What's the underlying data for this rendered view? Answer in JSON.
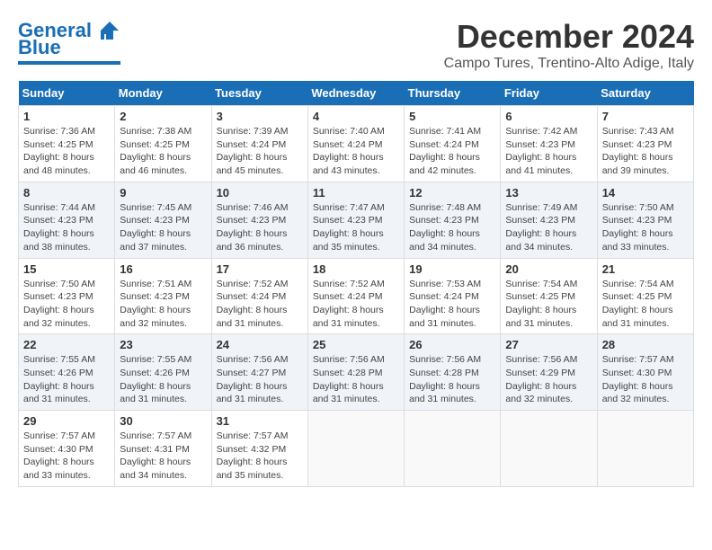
{
  "header": {
    "logo_general": "General",
    "logo_blue": "Blue",
    "title": "December 2024",
    "subtitle": "Campo Tures, Trentino-Alto Adige, Italy"
  },
  "calendar": {
    "days_of_week": [
      "Sunday",
      "Monday",
      "Tuesday",
      "Wednesday",
      "Thursday",
      "Friday",
      "Saturday"
    ],
    "weeks": [
      [
        null,
        null,
        null,
        null,
        null,
        null,
        null
      ]
    ],
    "cells": [
      {
        "day": null,
        "label": ""
      },
      {
        "day": null,
        "label": ""
      },
      {
        "day": null,
        "label": ""
      },
      {
        "day": null,
        "label": ""
      },
      {
        "day": null,
        "label": ""
      },
      {
        "day": null,
        "label": ""
      },
      {
        "day": null,
        "label": ""
      }
    ]
  },
  "days": {
    "week1": [
      {
        "num": "1",
        "sunrise": "Sunrise: 7:36 AM",
        "sunset": "Sunset: 4:25 PM",
        "daylight": "Daylight: 8 hours and 48 minutes."
      },
      {
        "num": "2",
        "sunrise": "Sunrise: 7:38 AM",
        "sunset": "Sunset: 4:25 PM",
        "daylight": "Daylight: 8 hours and 46 minutes."
      },
      {
        "num": "3",
        "sunrise": "Sunrise: 7:39 AM",
        "sunset": "Sunset: 4:24 PM",
        "daylight": "Daylight: 8 hours and 45 minutes."
      },
      {
        "num": "4",
        "sunrise": "Sunrise: 7:40 AM",
        "sunset": "Sunset: 4:24 PM",
        "daylight": "Daylight: 8 hours and 43 minutes."
      },
      {
        "num": "5",
        "sunrise": "Sunrise: 7:41 AM",
        "sunset": "Sunset: 4:24 PM",
        "daylight": "Daylight: 8 hours and 42 minutes."
      },
      {
        "num": "6",
        "sunrise": "Sunrise: 7:42 AM",
        "sunset": "Sunset: 4:23 PM",
        "daylight": "Daylight: 8 hours and 41 minutes."
      },
      {
        "num": "7",
        "sunrise": "Sunrise: 7:43 AM",
        "sunset": "Sunset: 4:23 PM",
        "daylight": "Daylight: 8 hours and 39 minutes."
      }
    ],
    "week2": [
      {
        "num": "8",
        "sunrise": "Sunrise: 7:44 AM",
        "sunset": "Sunset: 4:23 PM",
        "daylight": "Daylight: 8 hours and 38 minutes."
      },
      {
        "num": "9",
        "sunrise": "Sunrise: 7:45 AM",
        "sunset": "Sunset: 4:23 PM",
        "daylight": "Daylight: 8 hours and 37 minutes."
      },
      {
        "num": "10",
        "sunrise": "Sunrise: 7:46 AM",
        "sunset": "Sunset: 4:23 PM",
        "daylight": "Daylight: 8 hours and 36 minutes."
      },
      {
        "num": "11",
        "sunrise": "Sunrise: 7:47 AM",
        "sunset": "Sunset: 4:23 PM",
        "daylight": "Daylight: 8 hours and 35 minutes."
      },
      {
        "num": "12",
        "sunrise": "Sunrise: 7:48 AM",
        "sunset": "Sunset: 4:23 PM",
        "daylight": "Daylight: 8 hours and 34 minutes."
      },
      {
        "num": "13",
        "sunrise": "Sunrise: 7:49 AM",
        "sunset": "Sunset: 4:23 PM",
        "daylight": "Daylight: 8 hours and 34 minutes."
      },
      {
        "num": "14",
        "sunrise": "Sunrise: 7:50 AM",
        "sunset": "Sunset: 4:23 PM",
        "daylight": "Daylight: 8 hours and 33 minutes."
      }
    ],
    "week3": [
      {
        "num": "15",
        "sunrise": "Sunrise: 7:50 AM",
        "sunset": "Sunset: 4:23 PM",
        "daylight": "Daylight: 8 hours and 32 minutes."
      },
      {
        "num": "16",
        "sunrise": "Sunrise: 7:51 AM",
        "sunset": "Sunset: 4:23 PM",
        "daylight": "Daylight: 8 hours and 32 minutes."
      },
      {
        "num": "17",
        "sunrise": "Sunrise: 7:52 AM",
        "sunset": "Sunset: 4:24 PM",
        "daylight": "Daylight: 8 hours and 31 minutes."
      },
      {
        "num": "18",
        "sunrise": "Sunrise: 7:52 AM",
        "sunset": "Sunset: 4:24 PM",
        "daylight": "Daylight: 8 hours and 31 minutes."
      },
      {
        "num": "19",
        "sunrise": "Sunrise: 7:53 AM",
        "sunset": "Sunset: 4:24 PM",
        "daylight": "Daylight: 8 hours and 31 minutes."
      },
      {
        "num": "20",
        "sunrise": "Sunrise: 7:54 AM",
        "sunset": "Sunset: 4:25 PM",
        "daylight": "Daylight: 8 hours and 31 minutes."
      },
      {
        "num": "21",
        "sunrise": "Sunrise: 7:54 AM",
        "sunset": "Sunset: 4:25 PM",
        "daylight": "Daylight: 8 hours and 31 minutes."
      }
    ],
    "week4": [
      {
        "num": "22",
        "sunrise": "Sunrise: 7:55 AM",
        "sunset": "Sunset: 4:26 PM",
        "daylight": "Daylight: 8 hours and 31 minutes."
      },
      {
        "num": "23",
        "sunrise": "Sunrise: 7:55 AM",
        "sunset": "Sunset: 4:26 PM",
        "daylight": "Daylight: 8 hours and 31 minutes."
      },
      {
        "num": "24",
        "sunrise": "Sunrise: 7:56 AM",
        "sunset": "Sunset: 4:27 PM",
        "daylight": "Daylight: 8 hours and 31 minutes."
      },
      {
        "num": "25",
        "sunrise": "Sunrise: 7:56 AM",
        "sunset": "Sunset: 4:28 PM",
        "daylight": "Daylight: 8 hours and 31 minutes."
      },
      {
        "num": "26",
        "sunrise": "Sunrise: 7:56 AM",
        "sunset": "Sunset: 4:28 PM",
        "daylight": "Daylight: 8 hours and 31 minutes."
      },
      {
        "num": "27",
        "sunrise": "Sunrise: 7:56 AM",
        "sunset": "Sunset: 4:29 PM",
        "daylight": "Daylight: 8 hours and 32 minutes."
      },
      {
        "num": "28",
        "sunrise": "Sunrise: 7:57 AM",
        "sunset": "Sunset: 4:30 PM",
        "daylight": "Daylight: 8 hours and 32 minutes."
      }
    ],
    "week5": [
      {
        "num": "29",
        "sunrise": "Sunrise: 7:57 AM",
        "sunset": "Sunset: 4:30 PM",
        "daylight": "Daylight: 8 hours and 33 minutes."
      },
      {
        "num": "30",
        "sunrise": "Sunrise: 7:57 AM",
        "sunset": "Sunset: 4:31 PM",
        "daylight": "Daylight: 8 hours and 34 minutes."
      },
      {
        "num": "31",
        "sunrise": "Sunrise: 7:57 AM",
        "sunset": "Sunset: 4:32 PM",
        "daylight": "Daylight: 8 hours and 35 minutes."
      },
      null,
      null,
      null,
      null
    ]
  }
}
